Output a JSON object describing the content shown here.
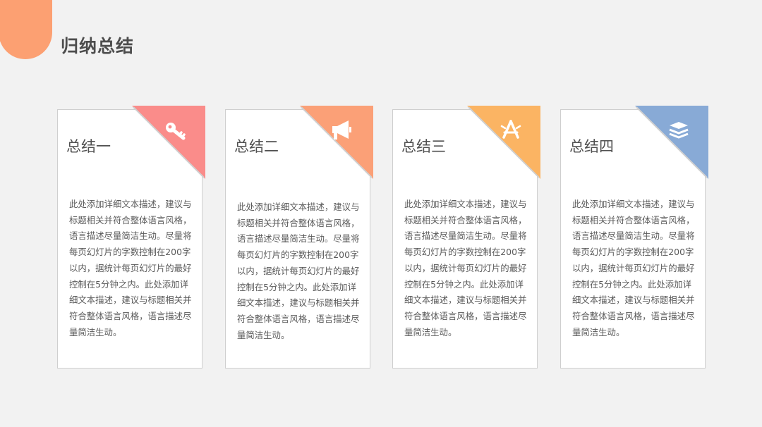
{
  "title": "归纳总结",
  "colors": {
    "accent": "#fca072",
    "card1": "#fa8c8a",
    "card2": "#fba077",
    "card3": "#fbb463",
    "card4": "#88aad6"
  },
  "cards": [
    {
      "title": "总结一",
      "icon": "key-icon",
      "body": "此处添加详细文本描述，建议与标题相关并符合整体语言风格，语言描述尽量简洁生动。尽量将每页幻灯片的字数控制在200字以内，据统计每页幻灯片的最好控制在5分钟之内。此处添加详细文本描述，建议与标题相关并符合整体语言风格，语言描述尽量简洁生动。"
    },
    {
      "title": "总结二",
      "icon": "megaphone-icon",
      "body": "此处添加详细文本描述，建议与标题相关并符合整体语言风格，语言描述尽量简洁生动。尽量将每页幻灯片的字数控制在200字以内，据统计每页幻灯片的最好控制在5分钟之内。此处添加详细文本描述，建议与标题相关并符合整体语言风格，语言描述尽量简洁生动。"
    },
    {
      "title": "总结三",
      "icon": "app-store-icon",
      "body": "此处添加详细文本描述，建议与标题相关并符合整体语言风格，语言描述尽量简洁生动。尽量将每页幻灯片的字数控制在200字以内，据统计每页幻灯片的最好控制在5分钟之内。此处添加详细文本描述，建议与标题相关并符合整体语言风格，语言描述尽量简洁生动。"
    },
    {
      "title": "总结四",
      "icon": "layers-icon",
      "body": "此处添加详细文本描述，建议与标题相关并符合整体语言风格，语言描述尽量简洁生动。尽量将每页幻灯片的字数控制在200字以内，据统计每页幻灯片的最好控制在5分钟之内。此处添加详细文本描述，建议与标题相关并符合整体语言风格，语言描述尽量简洁生动。"
    }
  ]
}
